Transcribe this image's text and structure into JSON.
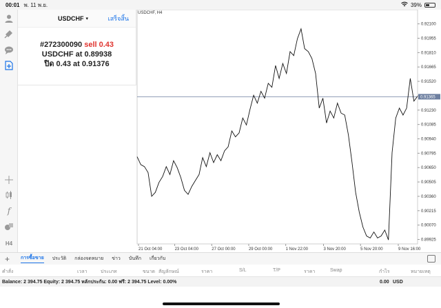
{
  "status_bar": {
    "time": "00:01",
    "date": "พ. 11 พ.ย.",
    "battery": "39%",
    "battery_level": 0.39
  },
  "order_panel": {
    "symbol": "USDCHF",
    "symbol_arrow": "▾",
    "done_label": "เสร็จสิ้น",
    "line1_prefix": "#272300090",
    "line1_action": "sell 0.43",
    "line2": "USDCHF at 0.89938",
    "line3": "ปิด 0.43 at 0.91376"
  },
  "toolbar_icons": [
    "user-icon",
    "share-icon",
    "chat-icon",
    "new-order-icon",
    "crosshair-icon",
    "candles-icon",
    "function-icon",
    "objects-icon",
    "timeframe-icon"
  ],
  "toolbar_timeframe": "H4",
  "colors": {
    "accent": "#1a73e8",
    "sell": "#e0342f",
    "price_line": "#6d7fa0"
  },
  "chart_data": {
    "type": "line",
    "title": "USDCHF, H4",
    "x_labels": [
      "21 Oct 04:00",
      "23 Oct 04:00",
      "27 Oct 00:00",
      "29 Oct 00:00",
      "1 Nov 22:00",
      "3 Nov 20:00",
      "5 Nov 20:00",
      "9 Nov 16:00"
    ],
    "y_ticks": [
      "0.92100",
      "0.91955",
      "0.91810",
      "0.91665",
      "0.91520",
      "0.91375",
      "0.91230",
      "0.91085",
      "0.90940",
      "0.90795",
      "0.90650",
      "0.90505",
      "0.90360",
      "0.90215",
      "0.90070",
      "0.89925"
    ],
    "ylim": [
      0.8988,
      0.9216
    ],
    "current_price": "0.91365",
    "current_price_value": 0.91365,
    "values": [
      0.9076,
      0.9068,
      0.9066,
      0.906,
      0.9036,
      0.904,
      0.905,
      0.9056,
      0.9066,
      0.9058,
      0.9072,
      0.9065,
      0.9055,
      0.9042,
      0.9038,
      0.9046,
      0.9052,
      0.9058,
      0.9075,
      0.9066,
      0.908,
      0.907,
      0.9078,
      0.9072,
      0.9082,
      0.9086,
      0.9102,
      0.9096,
      0.91,
      0.9115,
      0.9108,
      0.9124,
      0.9138,
      0.913,
      0.9142,
      0.9135,
      0.915,
      0.9146,
      0.9168,
      0.9155,
      0.917,
      0.916,
      0.9182,
      0.9178,
      0.9195,
      0.9205,
      0.9185,
      0.9182,
      0.9175,
      0.916,
      0.9125,
      0.9135,
      0.911,
      0.9122,
      0.9115,
      0.913,
      0.912,
      0.9118,
      0.9098,
      0.907,
      0.904,
      0.902,
      0.9005,
      0.8996,
      0.8994,
      0.9,
      0.8994,
      0.8996,
      0.9002,
      0.8992,
      0.908,
      0.9115,
      0.9125,
      0.9118,
      0.9125,
      0.9155,
      0.9132,
      0.9137
    ]
  },
  "bottom_tabs": [
    "การซื้อขาย",
    "ประวัติ",
    "กล่องจดหมาย",
    "ข่าว",
    "บันทึก",
    "เกี่ยวกับ"
  ],
  "table_columns": [
    "คำสั่ง",
    "เวลา",
    "ประเภท",
    "ขนาด",
    "สัญลักษณ์",
    "ราคา",
    "S/L",
    "T/P",
    "ราคา",
    "Swap",
    "กำไร",
    "หมายเหตุ"
  ],
  "balance": {
    "text": "Balance: 2 394.75 Equity: 2 394.75 หลักประกัน: 0.00 ฟรี: 2 394.75 Level: 0.00%",
    "profit": "0.00",
    "currency": "USD"
  }
}
